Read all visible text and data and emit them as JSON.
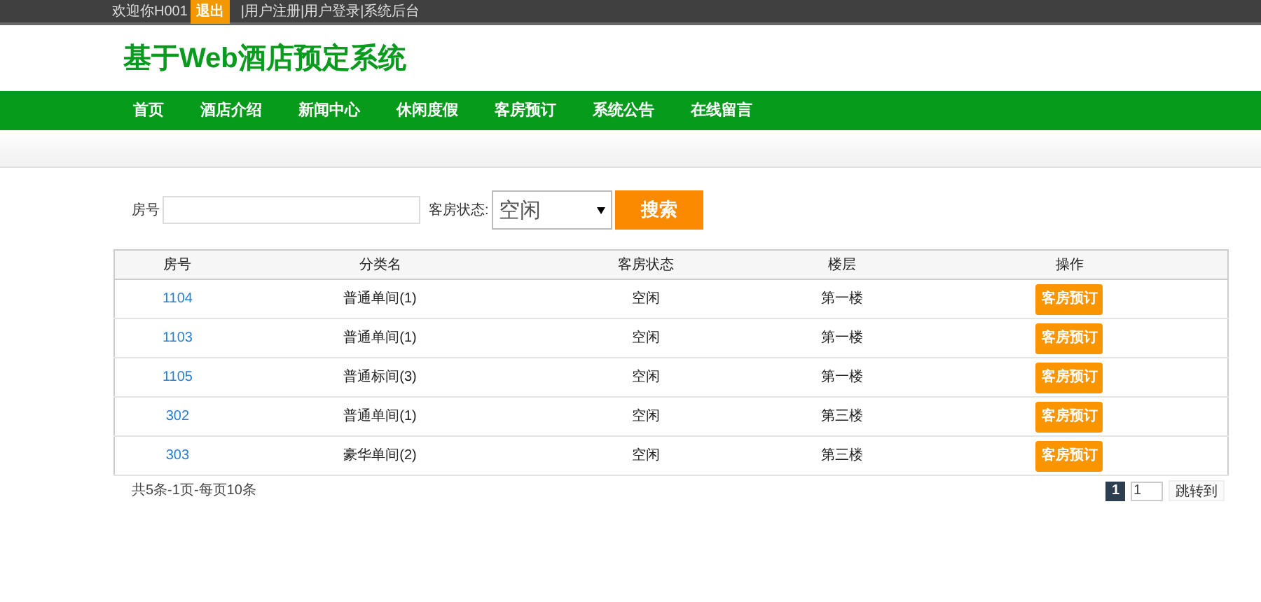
{
  "top_bar": {
    "welcome": "欢迎你H001",
    "logout": "退出",
    "links": [
      "|用户注册",
      "|用户登录",
      "|系统后台"
    ]
  },
  "site_title": "基于Web酒店预定系统",
  "nav": [
    {
      "label": "首页"
    },
    {
      "label": "酒店介绍"
    },
    {
      "label": "新闻中心"
    },
    {
      "label": "休闲度假"
    },
    {
      "label": "客房预订"
    },
    {
      "label": "系统公告"
    },
    {
      "label": "在线留言"
    }
  ],
  "search": {
    "room_label": "房号",
    "status_label": "客房状态:",
    "status_value": "空闲",
    "button": "搜索"
  },
  "table": {
    "columns": [
      "房号",
      "分类名",
      "客房状态",
      "楼层",
      "操作"
    ],
    "rows": [
      {
        "room": "1104",
        "category": "普通单间(1)",
        "status": "空闲",
        "floor": "第一楼",
        "action": "客房预订"
      },
      {
        "room": "1103",
        "category": "普通单间(1)",
        "status": "空闲",
        "floor": "第一楼",
        "action": "客房预订"
      },
      {
        "room": "1105",
        "category": "普通标间(3)",
        "status": "空闲",
        "floor": "第一楼",
        "action": "客房预订"
      },
      {
        "room": "302",
        "category": "普通单间(1)",
        "status": "空闲",
        "floor": "第三楼",
        "action": "客房预订"
      },
      {
        "room": "303",
        "category": "豪华单间(2)",
        "status": "空闲",
        "floor": "第三楼",
        "action": "客房预订"
      }
    ]
  },
  "pagination": {
    "summary": "共5条-1页-每页10条",
    "pages": [
      {
        "label": "1",
        "selected": true
      }
    ],
    "jump_value": "1",
    "jump_button": "跳转到"
  }
}
